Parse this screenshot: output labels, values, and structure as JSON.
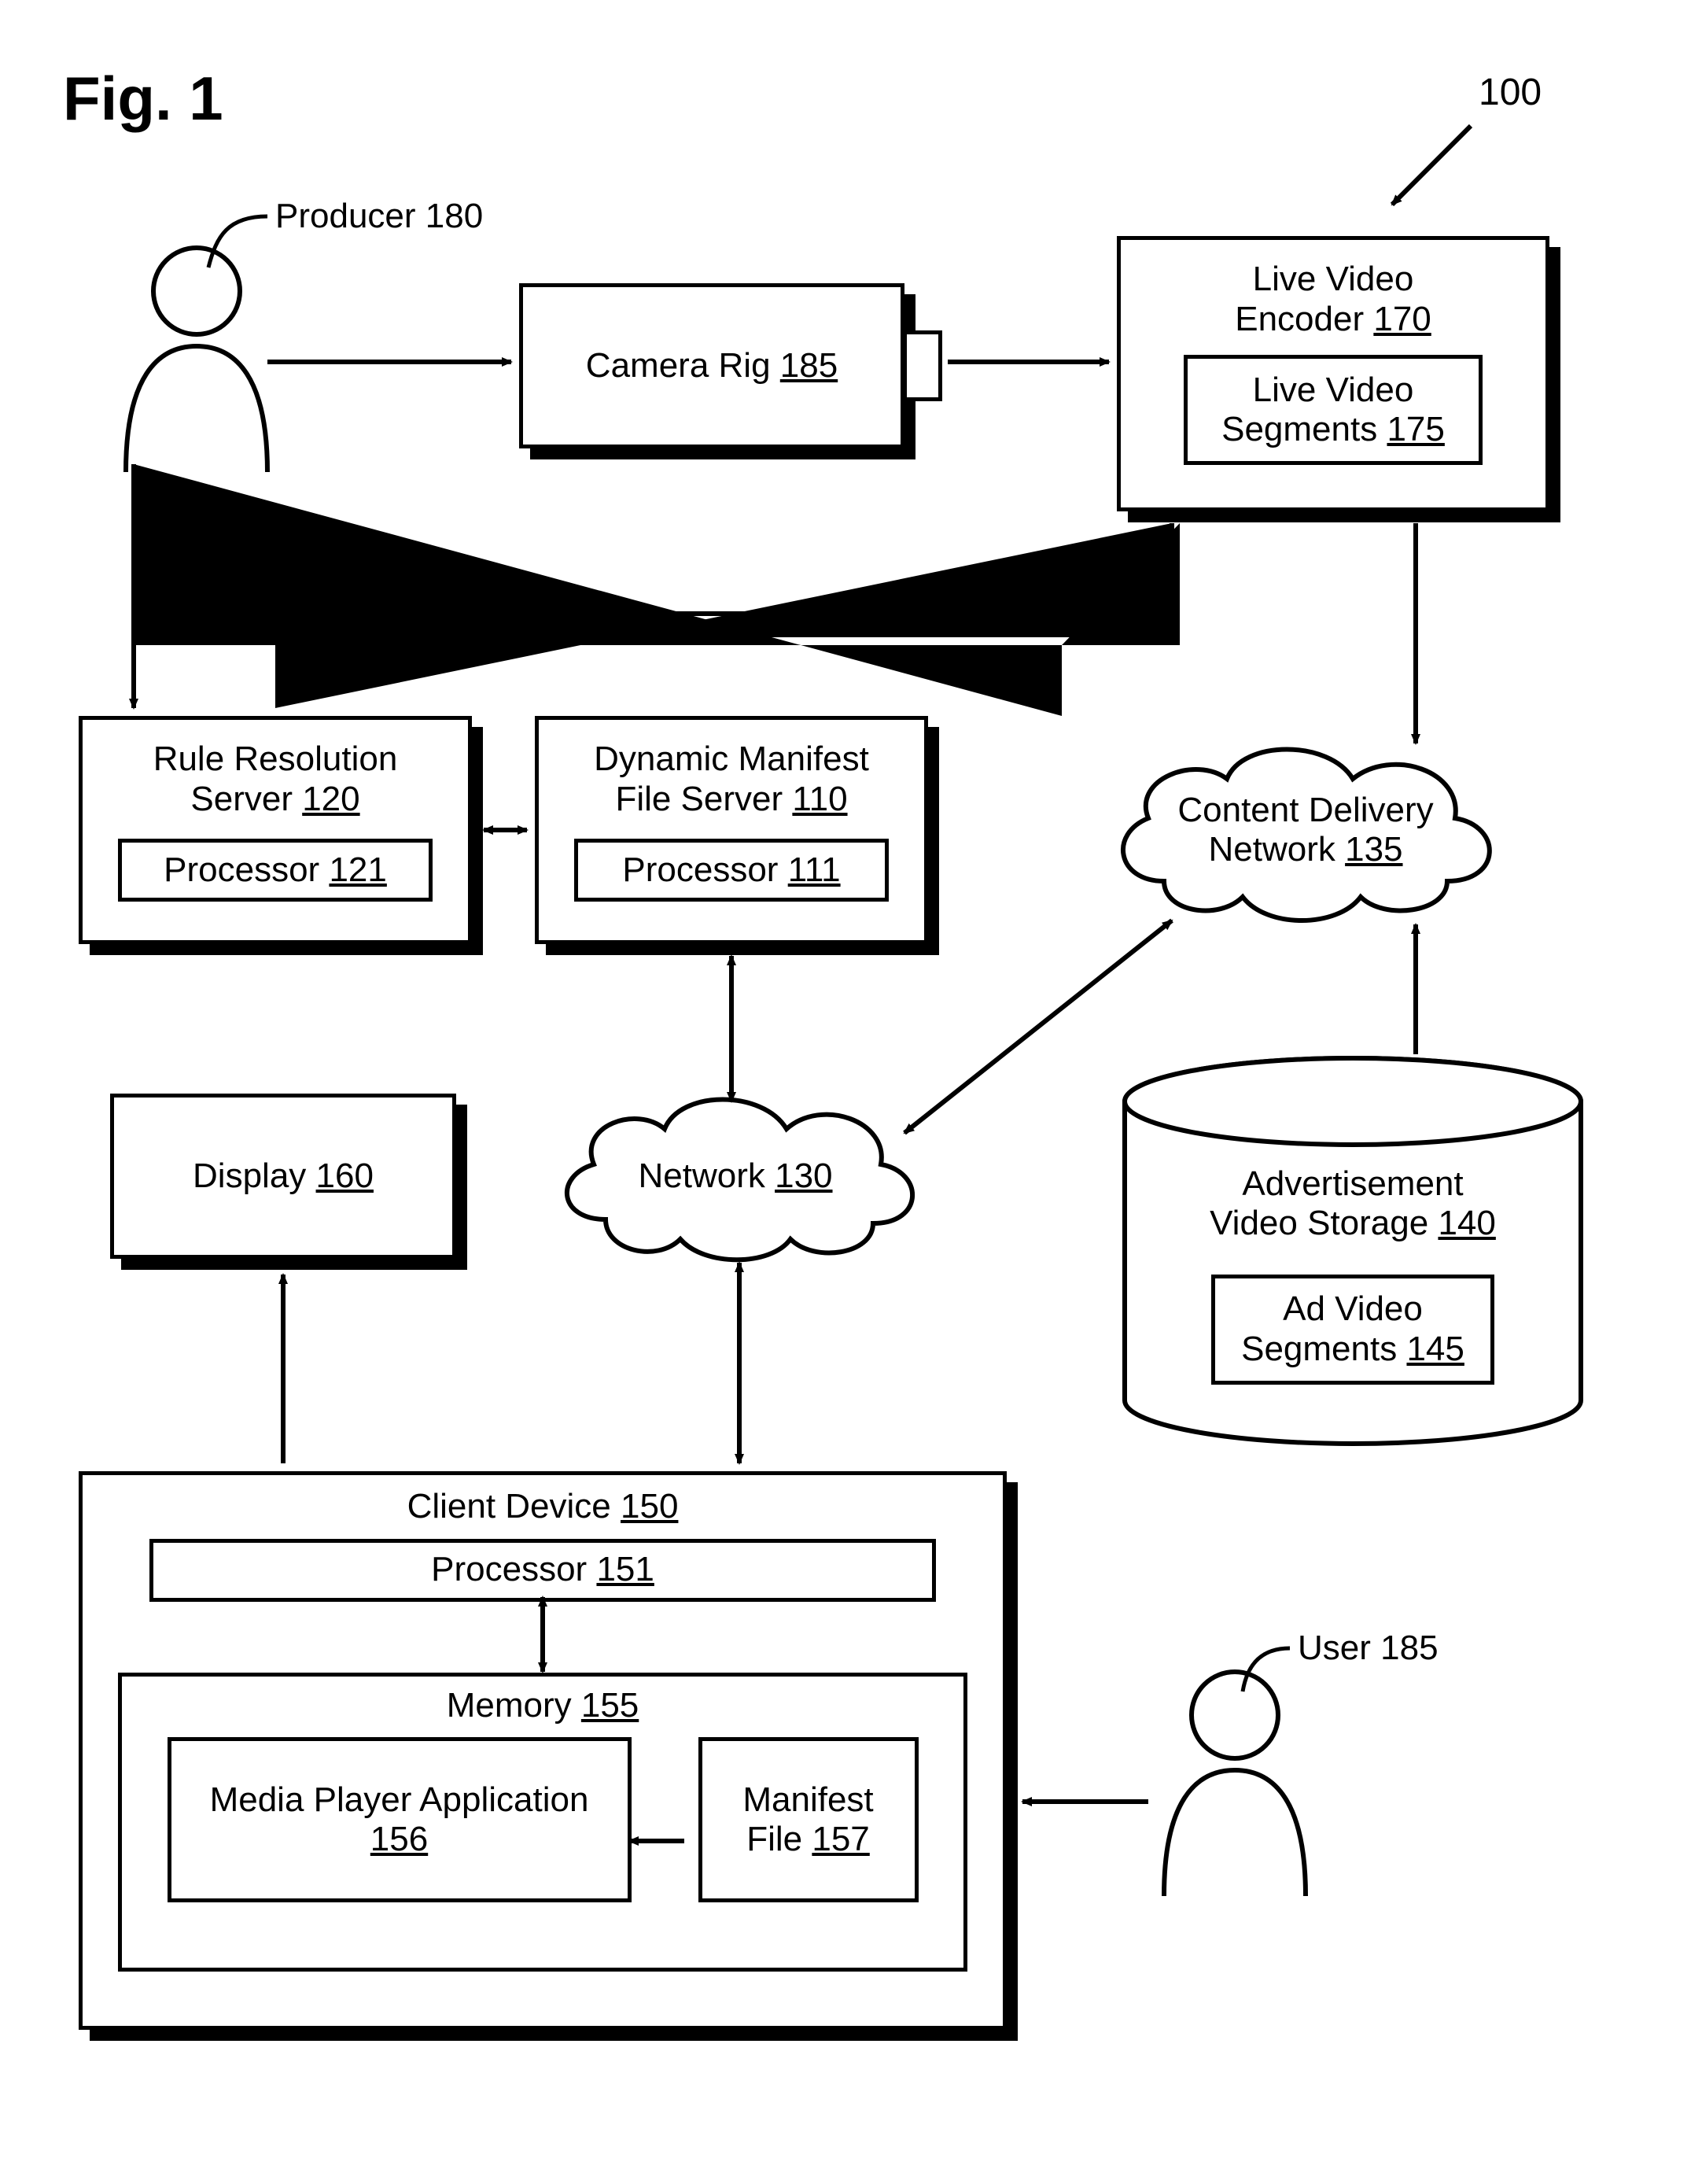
{
  "figTitle": "Fig. 1",
  "ref100": "100",
  "producer": {
    "label": "Producer",
    "num": "180"
  },
  "camera": {
    "label": "Camera Rig",
    "num": "185"
  },
  "encoder": {
    "label": "Live Video Encoder",
    "num": "170",
    "segLabel": "Live Video Segments",
    "segNum": "175"
  },
  "ruleServer": {
    "label": "Rule Resolution Server",
    "num": "120",
    "procLabel": "Processor",
    "procNum": "121"
  },
  "manifestServer": {
    "label": "Dynamic Manifest File Server",
    "num": "110",
    "procLabel": "Processor",
    "procNum": "111"
  },
  "cdn": {
    "label": "Content Delivery Network",
    "num": "135"
  },
  "network": {
    "label": "Network",
    "num": "130"
  },
  "display": {
    "label": "Display",
    "num": "160"
  },
  "adStorage": {
    "label": "Advertisement Video Storage",
    "num": "140",
    "segLabel": "Ad Video Segments",
    "segNum": "145"
  },
  "client": {
    "label": "Client Device",
    "num": "150",
    "procLabel": "Processor",
    "procNum": "151",
    "memLabel": "Memory",
    "memNum": "155",
    "mpaLabel": "Media Player Application",
    "mpaNum": "156",
    "mfLabel": "Manifest File",
    "mfNum": "157"
  },
  "user": {
    "label": "User",
    "num": "185"
  }
}
